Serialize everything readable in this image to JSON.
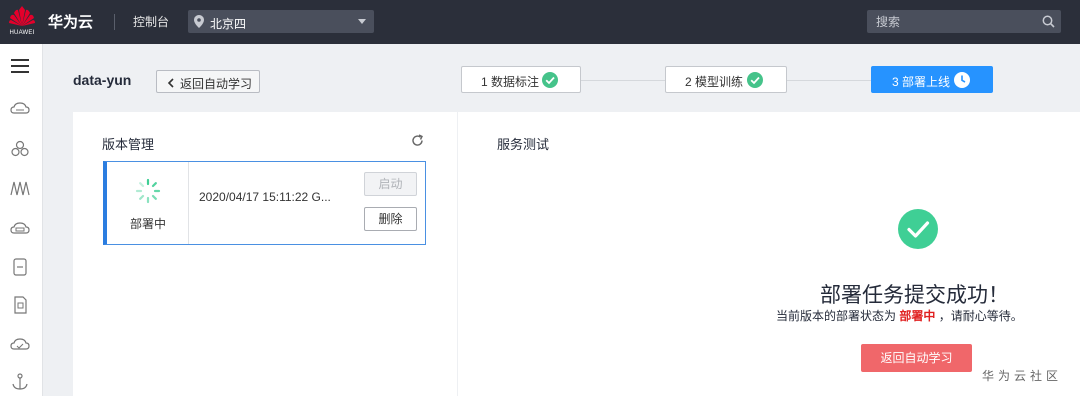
{
  "topbar": {
    "logo_text": "HUAWEI",
    "brand": "华为云",
    "console": "控制台",
    "region": "北京四",
    "search_placeholder": "搜索"
  },
  "header": {
    "project": "data-yun",
    "back_label": "返回自动学习"
  },
  "steps": [
    {
      "label": "1 数据标注",
      "status": "done"
    },
    {
      "label": "2 模型训练",
      "status": "done"
    },
    {
      "label": "3 部署上线",
      "status": "active"
    }
  ],
  "version_panel": {
    "title": "版本管理",
    "version": {
      "status": "部署中",
      "time": "2020/04/17 15:11:22 G...",
      "start_label": "启动",
      "delete_label": "删除"
    }
  },
  "service_panel": {
    "title": "服务测试",
    "success_title": "部署任务提交成功！",
    "msg_prefix": "当前版本的部署状态为",
    "msg_status": "部署中",
    "msg_suffix": "，请耐心等待。",
    "return_label": "返回自动学习"
  },
  "watermark": "华为云社区",
  "colors": {
    "topbar": "#2b2f3a",
    "step_active": "#2693ff",
    "success": "#3fcf95",
    "danger_button": "#f0676a",
    "status_red": "#e02020"
  }
}
